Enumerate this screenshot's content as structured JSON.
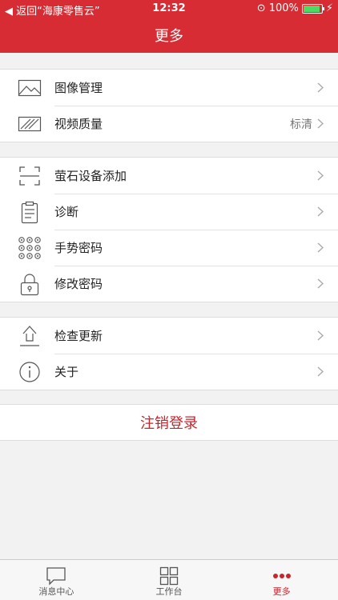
{
  "status_bar": {
    "back_label": "◀ 返回“海康零售云”",
    "time": "12:32",
    "battery": "100%",
    "battery_level": 1.0
  },
  "nav": {
    "title": "更多"
  },
  "groups": [
    {
      "rows": [
        {
          "icon": "image-icon",
          "label": "图像管理",
          "value": ""
        },
        {
          "icon": "video-quality-icon",
          "label": "视频质量",
          "value": "标清"
        }
      ]
    },
    {
      "rows": [
        {
          "icon": "scan-icon",
          "label": "萤石设备添加",
          "value": ""
        },
        {
          "icon": "clipboard-icon",
          "label": "诊断",
          "value": ""
        },
        {
          "icon": "gesture-dots-icon",
          "label": "手势密码",
          "value": ""
        },
        {
          "icon": "lock-icon",
          "label": "修改密码",
          "value": ""
        }
      ]
    },
    {
      "rows": [
        {
          "icon": "upload-arrow-icon",
          "label": "检查更新",
          "value": ""
        },
        {
          "icon": "info-icon",
          "label": "关于",
          "value": ""
        }
      ]
    }
  ],
  "logout": {
    "label": "注销登录"
  },
  "tabs": [
    {
      "label": "消息中心",
      "icon": "message-icon"
    },
    {
      "label": "工作台",
      "icon": "grid-icon"
    },
    {
      "label": "更多",
      "icon": "more-dots-icon"
    }
  ],
  "colors": {
    "brand": "#d72c33",
    "accent": "#c8242d"
  }
}
